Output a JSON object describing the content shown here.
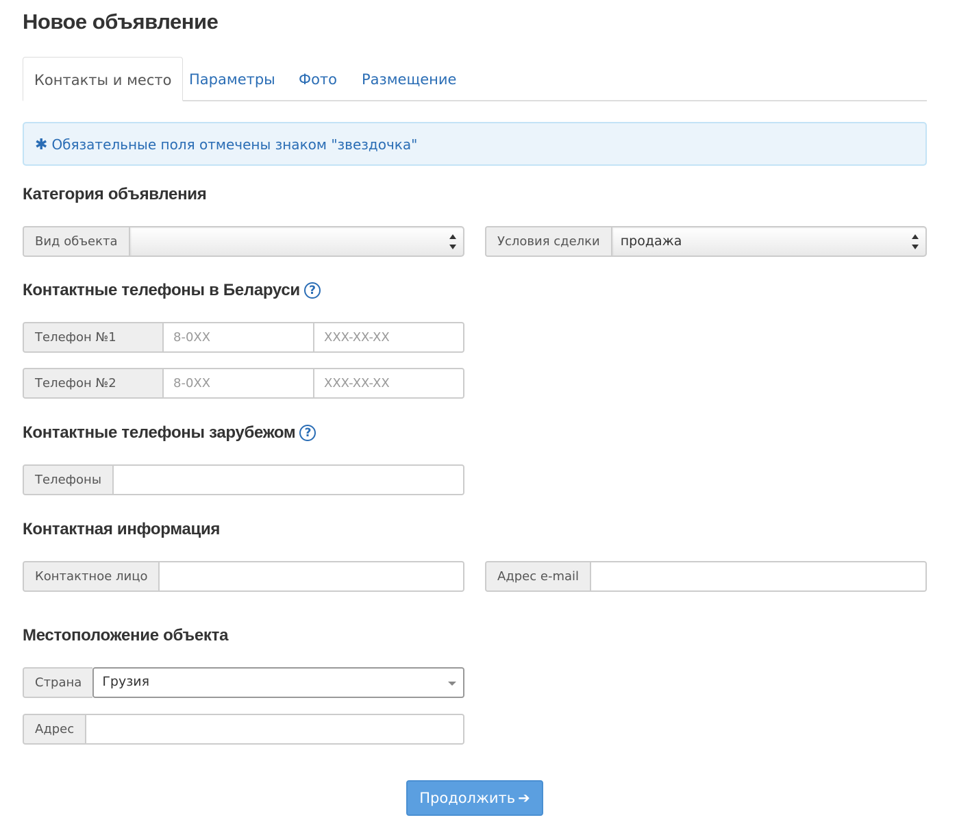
{
  "page": {
    "title": "Новое объявление"
  },
  "tabs": [
    {
      "label": "Контакты и место",
      "active": true
    },
    {
      "label": "Параметры"
    },
    {
      "label": "Фото"
    },
    {
      "label": "Размещение"
    }
  ],
  "alert": {
    "text": "Обязательные поля отмечены знаком \"звездочка\"",
    "icon": "asterisk-icon"
  },
  "category": {
    "title": "Категория объявления",
    "object_type": {
      "label": "Вид объекта",
      "value": ""
    },
    "deal_terms": {
      "label": "Условия сделки",
      "value": "продажа"
    }
  },
  "phones_by": {
    "title": "Контактные телефоны в Беларуси",
    "help": "?",
    "phone1": {
      "label": "Телефон №1",
      "code_placeholder": "8-0XX",
      "number_placeholder": "XXX-XX-XX"
    },
    "phone2": {
      "label": "Телефон №2",
      "code_placeholder": "8-0XX",
      "number_placeholder": "XXX-XX-XX"
    }
  },
  "phones_abroad": {
    "title": "Контактные телефоны зарубежом",
    "help": "?",
    "phones": {
      "label": "Телефоны",
      "value": ""
    }
  },
  "contact_info": {
    "title": "Контактная информация",
    "person": {
      "label": "Контактное лицо",
      "value": ""
    },
    "email": {
      "label": "Адрес e-mail",
      "value": ""
    }
  },
  "location": {
    "title": "Местоположение объекта",
    "country": {
      "label": "Страна",
      "value": "Грузия"
    },
    "address": {
      "label": "Адрес",
      "value": ""
    }
  },
  "continue_button": {
    "label": "Продолжить",
    "icon": "arrow-right-icon"
  },
  "colors": {
    "link": "#2a6db5",
    "alert_bg": "#ebf4fb",
    "button": "#5b9fe0"
  }
}
